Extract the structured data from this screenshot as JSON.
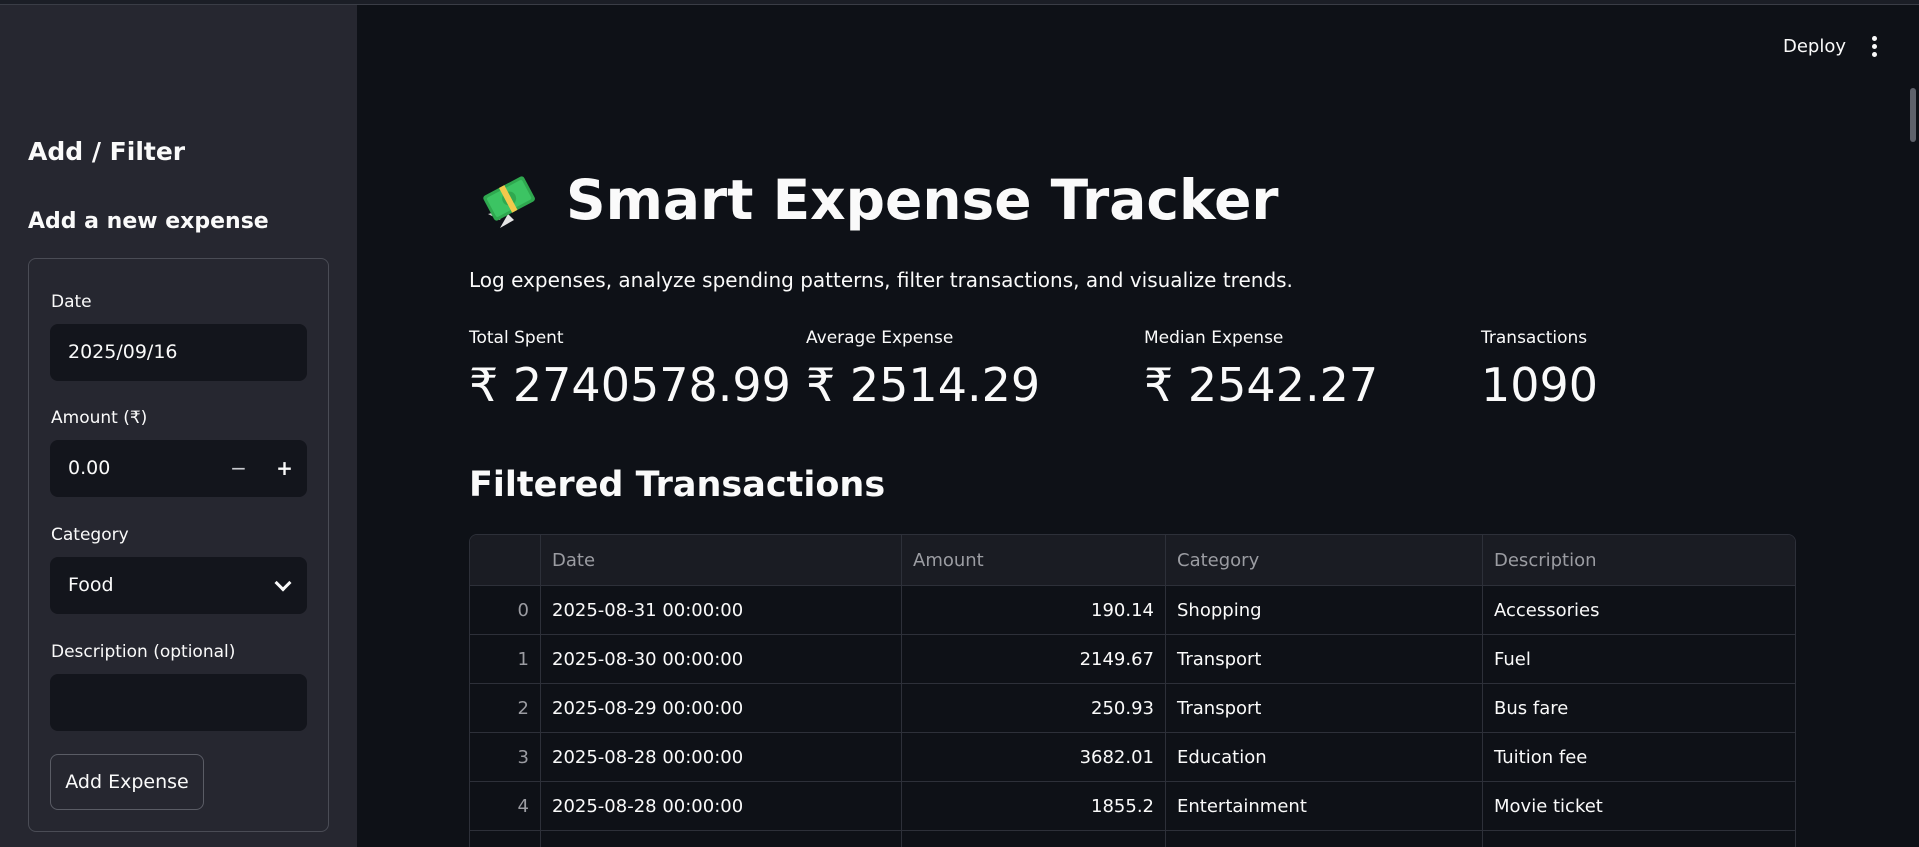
{
  "sidebar": {
    "title": "Add / Filter",
    "subtitle": "Add a new expense",
    "form": {
      "date_label": "Date",
      "date_value": "2025/09/16",
      "amount_label": "Amount (₹)",
      "amount_value": "0.00",
      "minus": "−",
      "plus": "+",
      "category_label": "Category",
      "category_value": "Food",
      "description_label": "Description (optional)",
      "description_value": "",
      "add_button": "Add Expense"
    }
  },
  "header": {
    "deploy": "Deploy"
  },
  "main": {
    "title": "Smart Expense Tracker",
    "subtitle": "Log expenses, analyze spending patterns, filter transactions, and visualize trends.",
    "metrics": [
      {
        "label": "Total Spent",
        "value": "₹ 2740578.99"
      },
      {
        "label": "Average Expense",
        "value": "₹ 2514.29"
      },
      {
        "label": "Median Expense",
        "value": "₹ 2542.27"
      },
      {
        "label": "Transactions",
        "value": "1090"
      }
    ],
    "section_title": "Filtered Transactions",
    "table": {
      "columns": [
        "",
        "Date",
        "Amount",
        "Category",
        "Description"
      ],
      "rows": [
        [
          "0",
          "2025-08-31 00:00:00",
          "190.14",
          "Shopping",
          "Accessories"
        ],
        [
          "1",
          "2025-08-30 00:00:00",
          "2149.67",
          "Transport",
          "Fuel"
        ],
        [
          "2",
          "2025-08-29 00:00:00",
          "250.93",
          "Transport",
          "Bus fare"
        ],
        [
          "3",
          "2025-08-28 00:00:00",
          "3682.01",
          "Education",
          "Tuition fee"
        ],
        [
          "4",
          "2025-08-28 00:00:00",
          "1855.2",
          "Entertainment",
          "Movie ticket"
        ]
      ]
    }
  },
  "colors": {
    "background": "#0e1117",
    "sidebar": "#262730",
    "input": "#13151c",
    "text": "#fafafa",
    "muted": "#9b9ca2"
  }
}
